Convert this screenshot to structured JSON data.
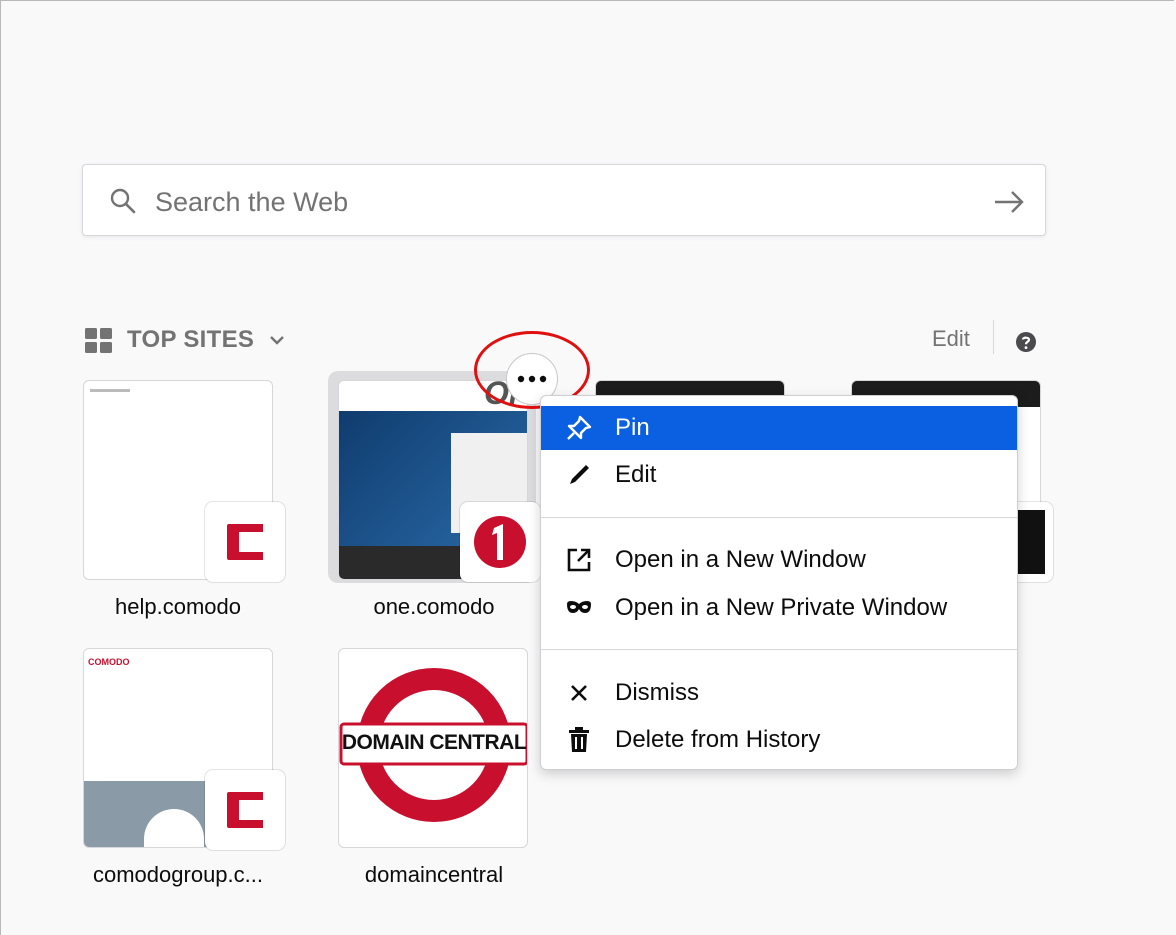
{
  "search": {
    "placeholder": "Search the Web"
  },
  "top_sites": {
    "title": "TOP SITES",
    "edit_label": "Edit",
    "tiles": [
      {
        "label": "help.comodo",
        "badge_letter": "C"
      },
      {
        "label": "one.comodo",
        "badge_letter": "1"
      },
      {
        "label": "",
        "badge_letter": ""
      },
      {
        "label": "",
        "badge_letter": ""
      },
      {
        "label": "comodogroup.c...",
        "badge_letter": "C"
      },
      {
        "label": "domaincentral",
        "badge_text": "DOMAIN CENTRAL"
      }
    ]
  },
  "context_menu": {
    "items": [
      {
        "label": "Pin",
        "icon": "pin-icon",
        "active": true
      },
      {
        "label": "Edit",
        "icon": "pencil-icon"
      },
      {
        "label": "Open in a New Window",
        "icon": "new-window-icon"
      },
      {
        "label": "Open in a New Private Window",
        "icon": "private-mask-icon"
      },
      {
        "label": "Dismiss",
        "icon": "close-icon"
      },
      {
        "label": "Delete from History",
        "icon": "trash-icon"
      }
    ]
  },
  "colors": {
    "accent": "#0a60e0",
    "comodo_red": "#c8102e",
    "highlight_ring": "#e01010"
  }
}
